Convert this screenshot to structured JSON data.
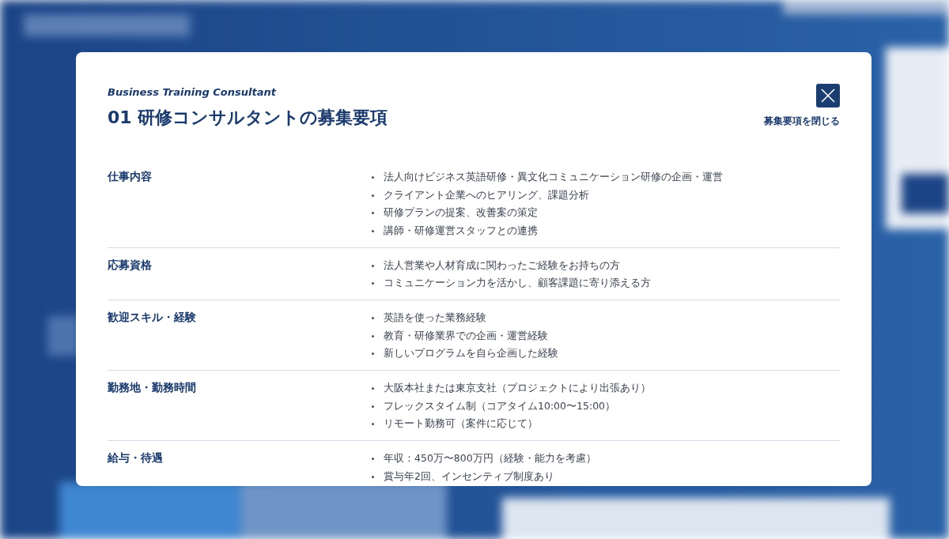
{
  "modal": {
    "subtitle": "Business Training Consultant",
    "number": "01",
    "title": "研修コンサルタントの募集要項",
    "close": {
      "label": "募集要項を閉じる"
    },
    "sections": [
      {
        "heading": "仕事内容",
        "items": [
          "法人向けビジネス英語研修・異文化コミュニケーション研修の企画・運営",
          "クライアント企業へのヒアリング、課題分析",
          "研修プランの提案、改善案の策定",
          "講師・研修運営スタッフとの連携"
        ]
      },
      {
        "heading": "応募資格",
        "items": [
          "法人営業や人材育成に関わったご経験をお持ちの方",
          "コミュニケーション力を活かし、顧客課題に寄り添える方"
        ]
      },
      {
        "heading": "歓迎スキル・経験",
        "items": [
          "英語を使った業務経験",
          "教育・研修業界での企画・運営経験",
          "新しいプログラムを自ら企画した経験"
        ]
      },
      {
        "heading": "勤務地・勤務時間",
        "items": [
          "大阪本社または東京支社（プロジェクトにより出張あり）",
          "フレックスタイム制（コアタイム10:00〜15:00）",
          "リモート勤務可（案件に応じて）"
        ]
      },
      {
        "heading": "給与・待遇",
        "items": [
          "年収：450万〜800万円（経験・能力を考慮）",
          "賞与年2回、インセンティブ制度あり"
        ]
      }
    ]
  }
}
